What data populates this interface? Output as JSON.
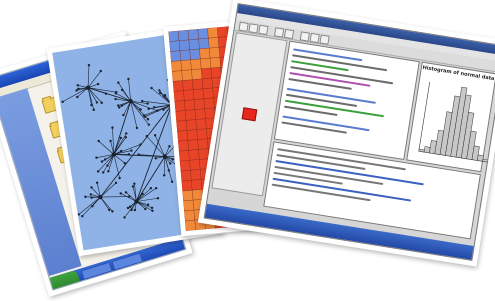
{
  "image": {
    "kind": "collage of four fanned-out screenshot printouts",
    "background": "#ffffff"
  },
  "sheets": {
    "desktop_window": {
      "colors": {
        "titlebar": "#2d63d8",
        "taskbar": "#1d49b5",
        "folder": "#f3cf5e"
      }
    },
    "network_graph": {
      "colors": {
        "background": "#8fb3e6",
        "edges": "#1a2230",
        "nodes": "#1a2230"
      }
    },
    "heat_map": {
      "colors": {
        "hot": "#e84428",
        "warm": "#f08a3a",
        "cool": "#6a8fe0",
        "grid": "#7a2a1a"
      }
    },
    "stats_ide": {
      "plot_title": "Histogram of normal data",
      "histogram_values": [
        0.03,
        0.08,
        0.18,
        0.34,
        0.62,
        0.86,
        1.0,
        0.9,
        0.66,
        0.4,
        0.2,
        0.08,
        0.03
      ],
      "colors": {
        "titlebar": "#2a4788",
        "statusbar": "#2349a6",
        "accent_red": "#e8261c",
        "bars": "#c8c8c8"
      }
    }
  }
}
